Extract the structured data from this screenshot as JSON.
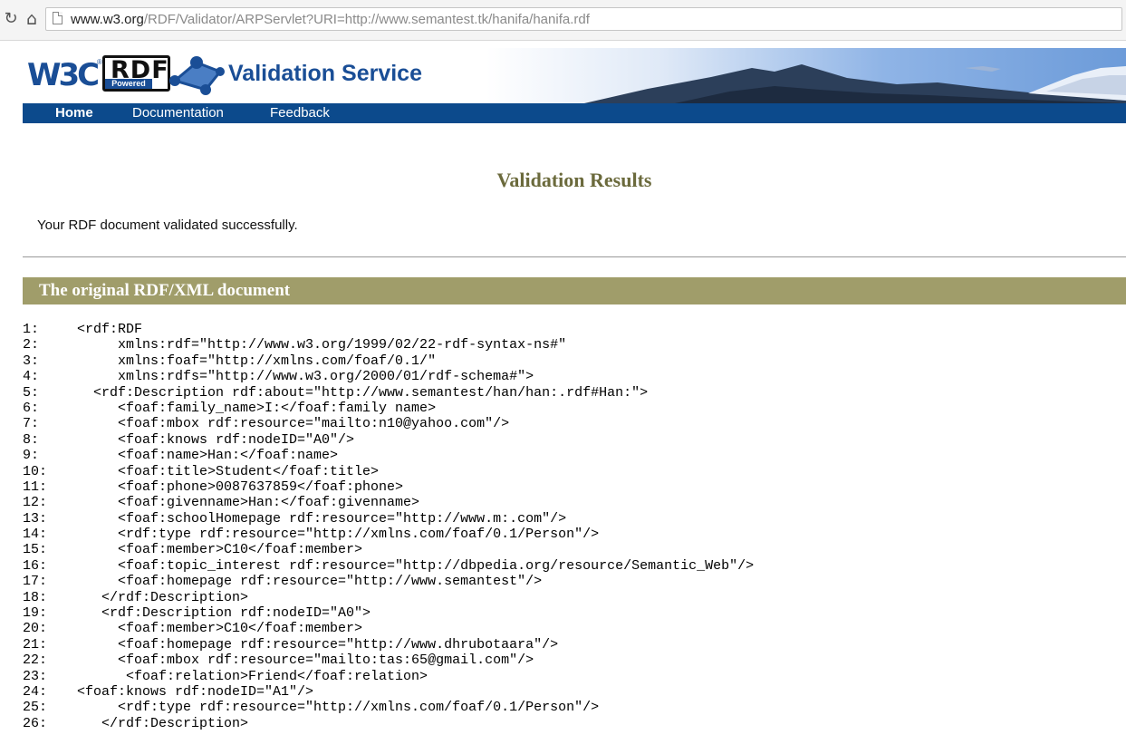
{
  "browser": {
    "url_host": "www.w3.org",
    "url_path": "/RDF/Validator/ARPServlet?URI=http://www.semantest.tk/hanifa/hanifa.rdf",
    "icons": [
      "reload-icon",
      "home-icon",
      "page-icon"
    ]
  },
  "banner": {
    "w3c_logo": "W3C",
    "w3c_reg": "®",
    "rdf_badge": "RDF",
    "powered": "Powered",
    "title": "Validation Service",
    "colors": {
      "brand_blue": "#1a4e96",
      "nav_blue": "#0c4a8c"
    }
  },
  "nav": {
    "home": "Home",
    "documentation": "Documentation",
    "feedback": "Feedback"
  },
  "main": {
    "heading": "Validation Results",
    "status": "Your RDF document validated successfully.",
    "section_title": "The original RDF/XML document",
    "section_color": "#a09d6a",
    "code_lines": [
      {
        "num": "1:",
        "text": "<rdf:RDF"
      },
      {
        "num": "2:",
        "text": "     xmlns:rdf=\"http://www.w3.org/1999/02/22-rdf-syntax-ns#\""
      },
      {
        "num": "3:",
        "text": "     xmlns:foaf=\"http://xmlns.com/foaf/0.1/\""
      },
      {
        "num": "4:",
        "text": "     xmlns:rdfs=\"http://www.w3.org/2000/01/rdf-schema#\">"
      },
      {
        "num": "5:",
        "text": "  <rdf:Description rdf:about=\"http://www.semantest/han/han:.rdf#Han:\">"
      },
      {
        "num": "6:",
        "text": "     <foaf:family_name>I:</foaf:family name>"
      },
      {
        "num": "7:",
        "text": "     <foaf:mbox rdf:resource=\"mailto:n10@yahoo.com\"/>"
      },
      {
        "num": "8:",
        "text": "     <foaf:knows rdf:nodeID=\"A0\"/>"
      },
      {
        "num": "9:",
        "text": "     <foaf:name>Han:</foaf:name>"
      },
      {
        "num": "10:",
        "text": "     <foaf:title>Student</foaf:title>"
      },
      {
        "num": "11:",
        "text": "     <foaf:phone>0087637859</foaf:phone>"
      },
      {
        "num": "12:",
        "text": "     <foaf:givenname>Han:</foaf:givenname>"
      },
      {
        "num": "13:",
        "text": "     <foaf:schoolHomepage rdf:resource=\"http://www.m:.com\"/>"
      },
      {
        "num": "14:",
        "text": "     <rdf:type rdf:resource=\"http://xmlns.com/foaf/0.1/Person\"/>"
      },
      {
        "num": "15:",
        "text": "     <foaf:member>C10</foaf:member>"
      },
      {
        "num": "16:",
        "text": "     <foaf:topic_interest rdf:resource=\"http://dbpedia.org/resource/Semantic_Web\"/>"
      },
      {
        "num": "17:",
        "text": "     <foaf:homepage rdf:resource=\"http://www.semantest\"/>"
      },
      {
        "num": "18:",
        "text": "   </rdf:Description>"
      },
      {
        "num": "19:",
        "text": "   <rdf:Description rdf:nodeID=\"A0\">"
      },
      {
        "num": "20:",
        "text": "     <foaf:member>C10</foaf:member>"
      },
      {
        "num": "21:",
        "text": "     <foaf:homepage rdf:resource=\"http://www.dhrubotaara\"/>"
      },
      {
        "num": "22:",
        "text": "     <foaf:mbox rdf:resource=\"mailto:tas:65@gmail.com\"/>"
      },
      {
        "num": "23:",
        "text": "      <foaf:relation>Friend</foaf:relation>"
      },
      {
        "num": "24:",
        "text": "<foaf:knows rdf:nodeID=\"A1\"/>"
      },
      {
        "num": "25:",
        "text": "     <rdf:type rdf:resource=\"http://xmlns.com/foaf/0.1/Person\"/>"
      },
      {
        "num": "26:",
        "text": "   </rdf:Description>"
      }
    ]
  }
}
